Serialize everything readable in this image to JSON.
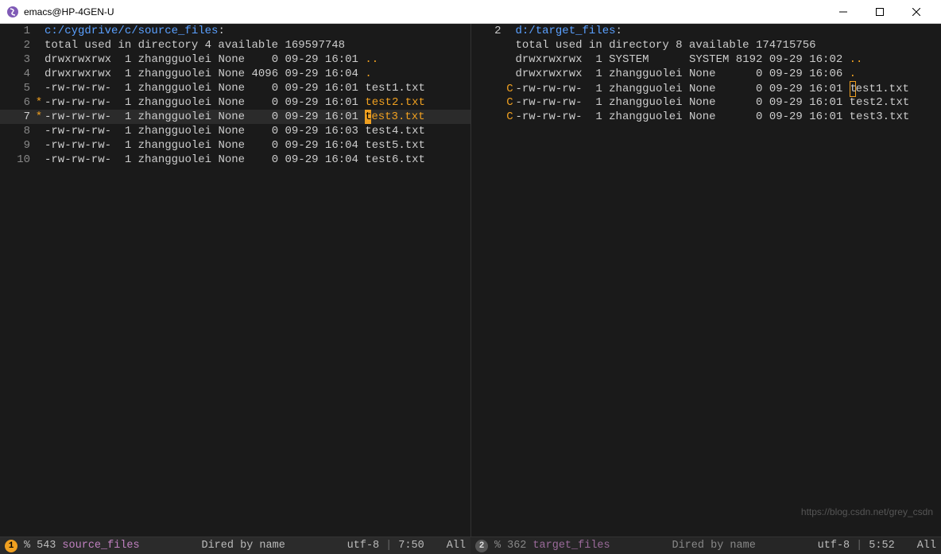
{
  "window": {
    "title": "emacs@HP-4GEN-U"
  },
  "left_pane": {
    "path": "c:/cygdrive/c/source_files",
    "totals": "total used in directory 4 available 169597748",
    "rows": [
      {
        "n": "1",
        "mark": "",
        "perm": "",
        "links": "",
        "owner": "",
        "group": "",
        "size": "",
        "date": "",
        "time": "",
        "fname": ""
      },
      {
        "n": "2",
        "mark": "",
        "perm": "",
        "links": "",
        "owner": "",
        "group": "",
        "size": "",
        "date": "",
        "time": "",
        "fname": ""
      },
      {
        "n": "3",
        "mark": "",
        "perm": "drwxrwxrwx",
        "links": "1",
        "owner": "zhangguolei",
        "group": "None",
        "size": "0",
        "date": "09-29",
        "time": "16:01",
        "fname": "..",
        "dir": true
      },
      {
        "n": "4",
        "mark": "",
        "perm": "drwxrwxrwx",
        "links": "1",
        "owner": "zhangguolei",
        "group": "None",
        "size": "4096",
        "date": "09-29",
        "time": "16:04",
        "fname": ".",
        "dir": true
      },
      {
        "n": "5",
        "mark": "",
        "perm": "-rw-rw-rw-",
        "links": "1",
        "owner": "zhangguolei",
        "group": "None",
        "size": "0",
        "date": "09-29",
        "time": "16:01",
        "fname": "test1.txt"
      },
      {
        "n": "6",
        "mark": "*",
        "perm": "-rw-rw-rw-",
        "links": "1",
        "owner": "zhangguolei",
        "group": "None",
        "size": "0",
        "date": "09-29",
        "time": "16:01",
        "fname": "test2.txt",
        "marked": true
      },
      {
        "n": "7",
        "mark": "*",
        "perm": "-rw-rw-rw-",
        "links": "1",
        "owner": "zhangguolei",
        "group": "None",
        "size": "0",
        "date": "09-29",
        "time": "16:01",
        "fname": "test3.txt",
        "marked": true,
        "current": true,
        "cursor": "t",
        "rest": "est3.txt"
      },
      {
        "n": "8",
        "mark": "",
        "perm": "-rw-rw-rw-",
        "links": "1",
        "owner": "zhangguolei",
        "group": "None",
        "size": "0",
        "date": "09-29",
        "time": "16:03",
        "fname": "test4.txt"
      },
      {
        "n": "9",
        "mark": "",
        "perm": "-rw-rw-rw-",
        "links": "1",
        "owner": "zhangguolei",
        "group": "None",
        "size": "0",
        "date": "09-29",
        "time": "16:04",
        "fname": "test5.txt"
      },
      {
        "n": "10",
        "mark": "",
        "perm": "-rw-rw-rw-",
        "links": "1",
        "owner": "zhangguolei",
        "group": "None",
        "size": "0",
        "date": "09-29",
        "time": "16:04",
        "fname": "test6.txt"
      }
    ]
  },
  "right_pane": {
    "path": "d:/target_files",
    "totals": "total used in directory 8 available 174715756",
    "rows": [
      {
        "n": "2",
        "mark": "",
        "perm": "",
        "links": "",
        "owner": "",
        "group": "",
        "size": "",
        "date": "",
        "time": "",
        "fname": ""
      },
      {
        "n": "",
        "mark": "",
        "perm": "drwxrwxrwx",
        "links": "1",
        "owner": "SYSTEM",
        "group": "SYSTEM",
        "size": "8192",
        "date": "09-29",
        "time": "16:02",
        "fname": "..",
        "dir": true
      },
      {
        "n": "",
        "mark": "",
        "perm": "drwxrwxrwx",
        "links": "1",
        "owner": "zhangguolei",
        "group": "None",
        "size": "0",
        "date": "09-29",
        "time": "16:06",
        "fname": ".",
        "dir": true
      },
      {
        "n": "",
        "mark": "C",
        "perm": "-rw-rw-rw-",
        "links": "1",
        "owner": "zhangguolei",
        "group": "None",
        "size": "0",
        "date": "09-29",
        "time": "16:01",
        "fname": "test1.txt",
        "cursor": "t",
        "rest": "est1.txt"
      },
      {
        "n": "",
        "mark": "C",
        "perm": "-rw-rw-rw-",
        "links": "1",
        "owner": "zhangguolei",
        "group": "None",
        "size": "0",
        "date": "09-29",
        "time": "16:01",
        "fname": "test2.txt"
      },
      {
        "n": "",
        "mark": "C",
        "perm": "-rw-rw-rw-",
        "links": "1",
        "owner": "zhangguolei",
        "group": "None",
        "size": "0",
        "date": "09-29",
        "time": "16:01",
        "fname": "test3.txt"
      }
    ]
  },
  "modeline_left": {
    "badge": "1",
    "modified": "%",
    "size": "543",
    "bufname": "source_files",
    "mode": "Dired by name",
    "enc": "utf-8",
    "pos": "7:50",
    "pct": "All"
  },
  "modeline_right": {
    "badge": "2",
    "modified": "%",
    "size": "362",
    "bufname": "target_files",
    "mode": "Dired by name",
    "enc": "utf-8",
    "pos": "5:52",
    "pct": "All"
  },
  "watermark": "https://blog.csdn.net/grey_csdn"
}
